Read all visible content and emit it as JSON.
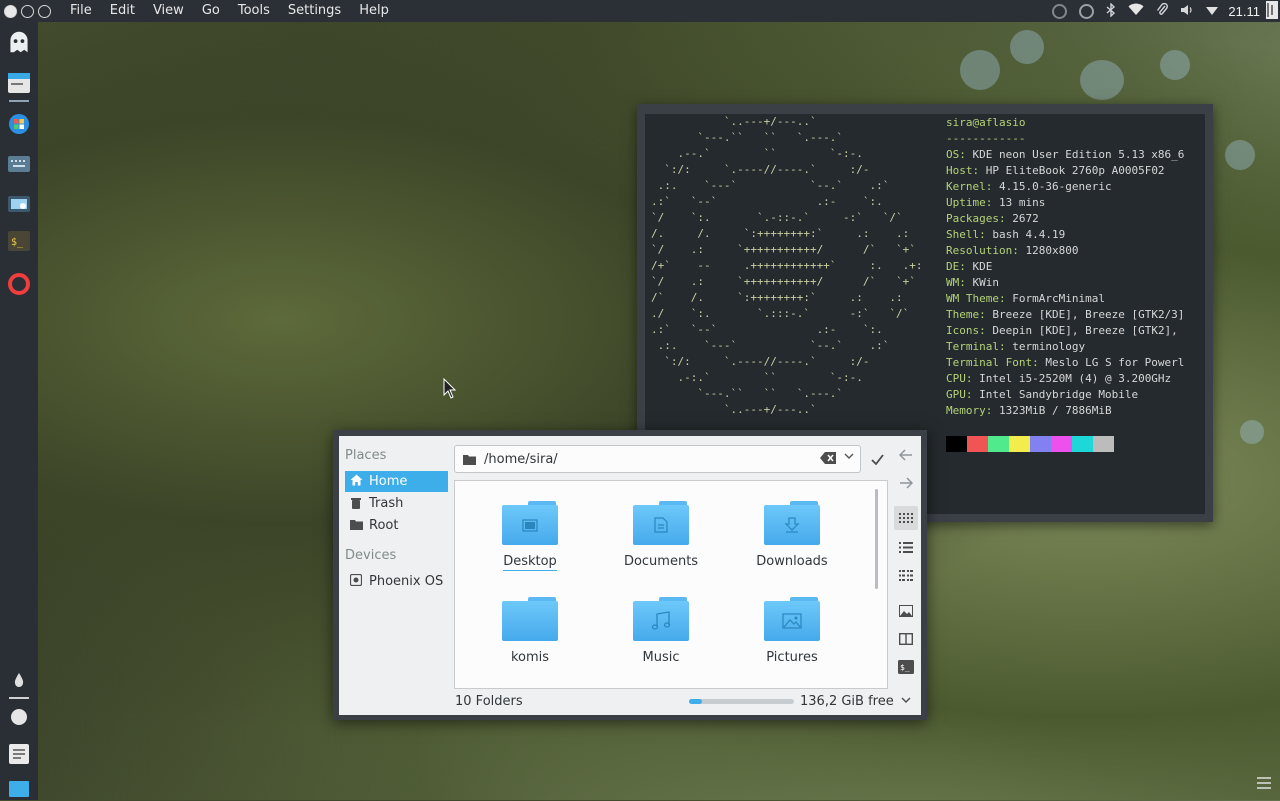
{
  "menubar": {
    "items": [
      "File",
      "Edit",
      "View",
      "Go",
      "Tools",
      "Settings",
      "Help"
    ]
  },
  "tray": {
    "icons": [
      "circle-indicator-icon",
      "circle-indicator-icon",
      "bluetooth-icon",
      "wifi-icon",
      "attachment-icon",
      "volume-icon",
      "expand-icon"
    ],
    "clock": "21.11"
  },
  "dock": {
    "items": [
      "ghost-app-icon",
      "file-manager-icon",
      "color-app-icon",
      "keyboard-icon",
      "screenshot-icon",
      "terminal-icon",
      "opera-icon"
    ],
    "bottom": [
      "droplet-icon",
      "circle-icon",
      "document-icon",
      "desktop-icon"
    ]
  },
  "terminal": {
    "ascii": "           `..---+/---..`\n       `---.``   ``   `.---.`\n    .--.`        ``        `-:-.\n  `:/:     `.----//----.`     :/-\n .:.    `---`           `--.`    .:`\n.:`   `--`               .:-    `:.\n`/    `:.       `.-::-.`     -:`   `/`\n/.     /.     `:++++++++:`     .:    .:\n`/    .:     `+++++++++++/      /`   `+`\n/+`    --     .++++++++++++`     :.   .+:\n`/    .:     `+++++++++++/      /`   `+`\n/`    /.     `:++++++++:`     .:    .:\n./    `:.       `.:::-.`      -:`   `/`\n.:`   `--`               .:-    `:.\n .:.    `---`           `--.`    .:`\n  `:/:     `.----//----.`     :/-\n    .-:.`        ``        `-:-.\n       `---.``   ``   `.---.`\n           `..---+/---..`",
    "user_host": "sira@aflasio",
    "separator": "------------",
    "info": [
      {
        "key": "OS:",
        "value": "KDE neon User Edition 5.13 x86_6"
      },
      {
        "key": "Host:",
        "value": "HP EliteBook 2760p A0005F02"
      },
      {
        "key": "Kernel:",
        "value": "4.15.0-36-generic"
      },
      {
        "key": "Uptime:",
        "value": "13 mins"
      },
      {
        "key": "Packages:",
        "value": "2672"
      },
      {
        "key": "Shell:",
        "value": "bash 4.4.19"
      },
      {
        "key": "Resolution:",
        "value": "1280x800"
      },
      {
        "key": "DE:",
        "value": "KDE"
      },
      {
        "key": "WM:",
        "value": "KWin"
      },
      {
        "key": "WM Theme:",
        "value": "FormArcMinimal"
      },
      {
        "key": "Theme:",
        "value": "Breeze [KDE], Breeze [GTK2/3]"
      },
      {
        "key": "Icons:",
        "value": "Deepin [KDE], Breeze [GTK2],"
      },
      {
        "key": "Terminal:",
        "value": "terminology"
      },
      {
        "key": "Terminal Font:",
        "value": "Meslo LG S for Powerl"
      },
      {
        "key": "CPU:",
        "value": "Intel i5-2520M (4) @ 3.200GHz"
      },
      {
        "key": "GPU:",
        "value": "Intel Sandybridge Mobile"
      },
      {
        "key": "Memory:",
        "value": "1323MiB / 7886MiB"
      }
    ],
    "palette": [
      "#000000",
      "#f05454",
      "#50ea8c",
      "#f2ed4c",
      "#8181f2",
      "#ee50ee",
      "#1ed8d8",
      "#bcbcbc"
    ]
  },
  "filedialog": {
    "places_header": "Places",
    "places": [
      {
        "label": "Home",
        "icon": "home-icon",
        "selected": true
      },
      {
        "label": "Trash",
        "icon": "trash-icon",
        "selected": false
      },
      {
        "label": "Root",
        "icon": "folder-icon",
        "selected": false
      }
    ],
    "devices_header": "Devices",
    "devices": [
      {
        "label": "Phoenix OS",
        "icon": "drive-icon"
      }
    ],
    "path": "/home/sira/",
    "folders": [
      {
        "label": "Desktop",
        "emblem": "desktop-emblem"
      },
      {
        "label": "Documents",
        "emblem": "document-emblem"
      },
      {
        "label": "Downloads",
        "emblem": "download-emblem"
      },
      {
        "label": "komis",
        "emblem": ""
      },
      {
        "label": "Music",
        "emblem": "music-emblem"
      },
      {
        "label": "Pictures",
        "emblem": "picture-emblem"
      }
    ],
    "status": "10 Folders",
    "free": "136,2 GiB free",
    "used_fraction": 0.12
  }
}
